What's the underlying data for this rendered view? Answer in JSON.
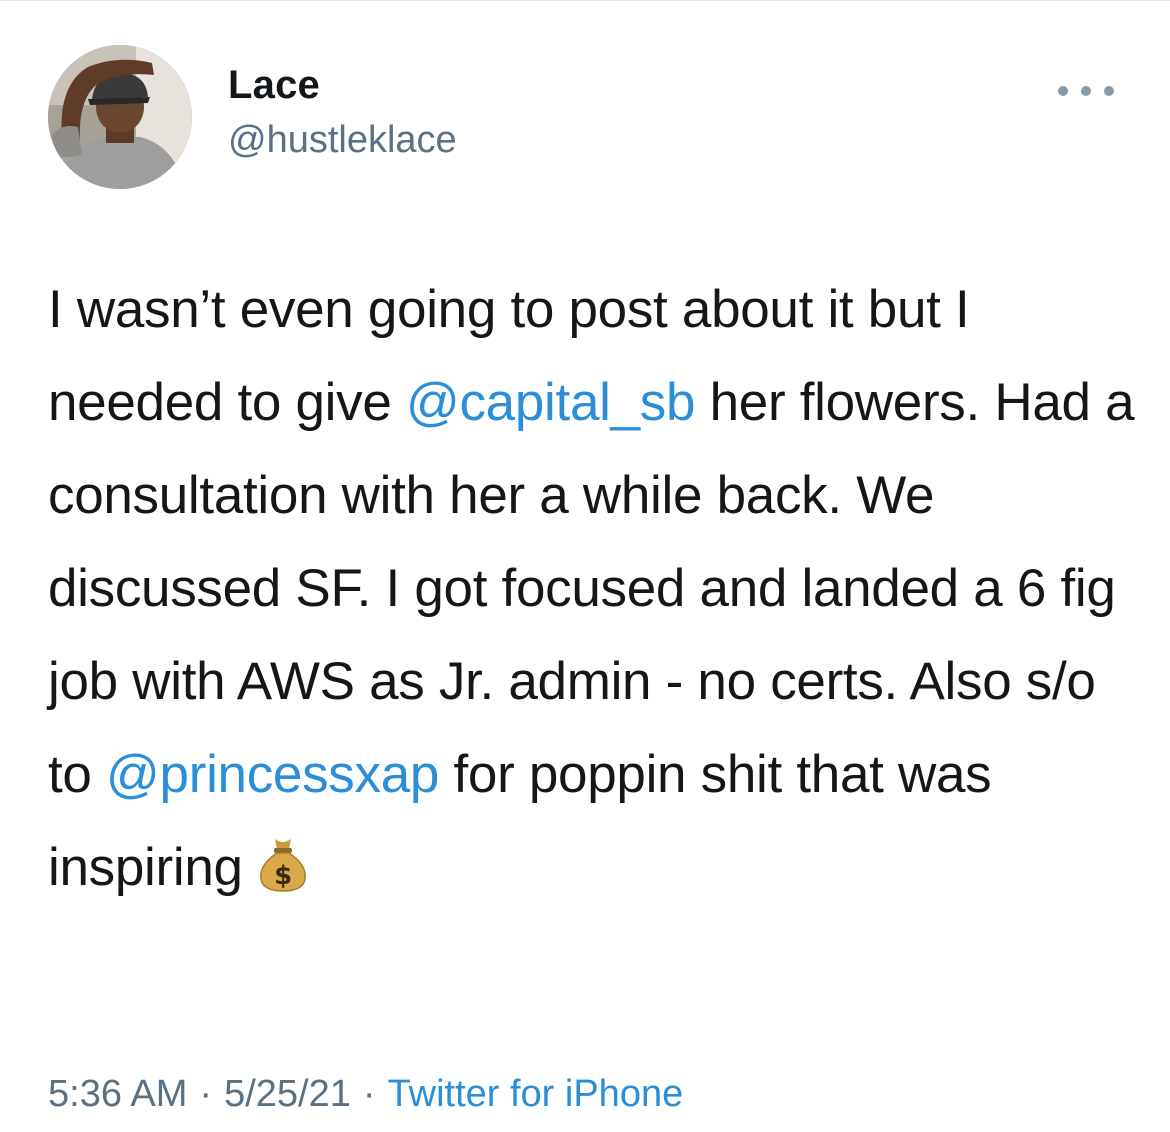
{
  "tweet": {
    "author": {
      "name": "Lace",
      "handle": "@hustleklace"
    },
    "text": {
      "part1": "I wasn’t even going to post about it but I needed to give",
      "mention1": "@capital_sb",
      "part2": "her flowers. Had a consultation with her a while back. We discussed SF. I got focused and landed a 6 fig job with AWS as Jr. admin - no certs. Also s/o to",
      "mention2": "@princessxap",
      "part3": "for poppin shit that was inspiring",
      "emoji_name": "money-bag-icon"
    },
    "meta": {
      "time": "5:36 AM",
      "separator": "·",
      "date": "5/25/21",
      "source": "Twitter for iPhone"
    },
    "colors": {
      "link": "#2b8ed8",
      "secondary_text": "#5b7083",
      "primary_text": "#14171a"
    }
  }
}
